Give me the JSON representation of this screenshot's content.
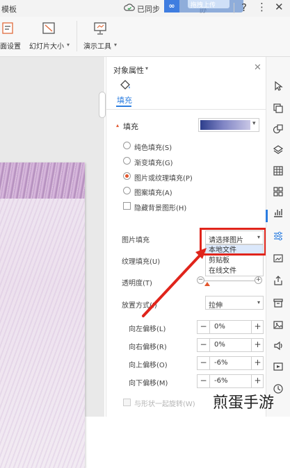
{
  "titlebar": {
    "title_fragment": "模板",
    "sync_label": "已同步",
    "toast_hint": "拖拽上传",
    "toast_logo": "∞",
    "toast_under_text": "协",
    "help": "?",
    "more": "⋮",
    "close": "✕"
  },
  "ribbon": {
    "items": [
      {
        "label": "面设置",
        "icon": "page-setup-icon"
      },
      {
        "label": "幻灯片大小",
        "icon": "slide-size-icon"
      },
      {
        "label": "演示工具",
        "icon": "presentation-tools-icon"
      }
    ],
    "dropdown_caret": "▾"
  },
  "pane": {
    "title": "对象属性",
    "title_caret": "▾",
    "close": "✕",
    "tab": "填充",
    "section": "填充",
    "section_caret": "▴",
    "fill_options": [
      {
        "label": "纯色填充(S)",
        "selected": false
      },
      {
        "label": "渐变填充(G)",
        "selected": false
      },
      {
        "label": "图片或纹理填充(P)",
        "selected": true
      },
      {
        "label": "图案填充(A)",
        "selected": false
      }
    ],
    "hide_bg_label": "隐藏背景图形(H)",
    "picture_fill": {
      "label": "图片填充",
      "value": "请选择图片",
      "caret": "▾",
      "options": [
        "本地文件",
        "剪贴板",
        "在线文件"
      ]
    },
    "texture_fill_label": "纹理填充(U)",
    "transparency_label": "透明度(T)",
    "placement": {
      "label": "放置方式(I)",
      "value": "拉伸",
      "caret": "▾"
    },
    "offsets": [
      {
        "label": "向左偏移(L)",
        "value": "0%"
      },
      {
        "label": "向右偏移(R)",
        "value": "0%"
      },
      {
        "label": "向上偏移(O)",
        "value": "-6%"
      },
      {
        "label": "向下偏移(M)",
        "value": "-6%"
      }
    ],
    "minus": "−",
    "plus": "+",
    "rotate_label": "与形状一起旋转(W)"
  },
  "colors": {
    "accent": "#2b7de0",
    "highlight_red": "#e0241b",
    "selected_radio": "#e3562d"
  },
  "watermark": "煎蛋手游"
}
